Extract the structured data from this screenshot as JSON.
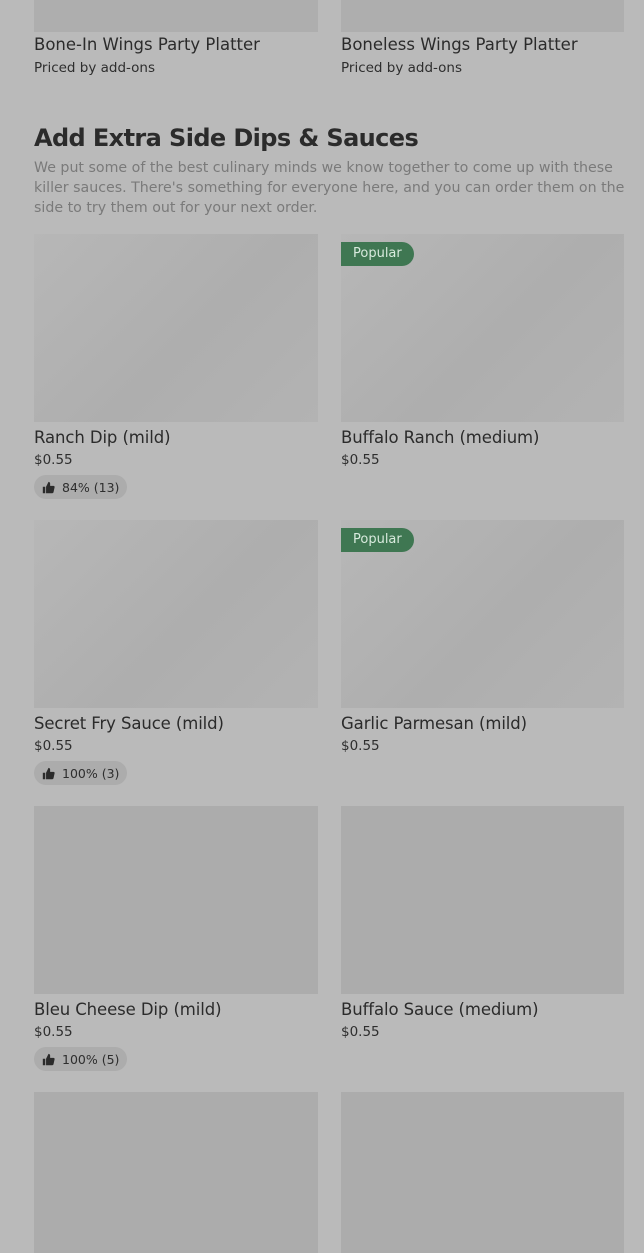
{
  "top_items": [
    {
      "name": "Bone-In Wings Party Platter",
      "subtitle": "Priced by add-ons"
    },
    {
      "name": "Boneless Wings Party Platter",
      "subtitle": "Priced by add-ons"
    }
  ],
  "section": {
    "title": "Add Extra Side Dips & Sauces",
    "description": "We put some of the best culinary minds we know together to come up with these killer sauces. There's something for everyone here, and you can order them on the side to try them out for your next order."
  },
  "items": [
    {
      "name": "Ranch Dip (mild)",
      "price": "$0.55",
      "rating": "84% (13)",
      "badge": ""
    },
    {
      "name": "Buffalo Ranch (medium)",
      "price": "$0.55",
      "rating": "",
      "badge": "Popular"
    },
    {
      "name": "Secret Fry Sauce (mild)",
      "price": "$0.55",
      "rating": "100% (3)",
      "badge": ""
    },
    {
      "name": "Garlic Parmesan (mild)",
      "price": "$0.55",
      "rating": "",
      "badge": "Popular"
    },
    {
      "name": "Bleu Cheese Dip (mild)",
      "price": "$0.55",
      "rating": "100% (5)",
      "badge": ""
    },
    {
      "name": "Buffalo Sauce (medium)",
      "price": "$0.55",
      "rating": "",
      "badge": ""
    }
  ],
  "icons": {
    "rating": "thumbs-up-icon"
  },
  "colors": {
    "badge_bg": "#3f7752",
    "background": "#bababa"
  }
}
